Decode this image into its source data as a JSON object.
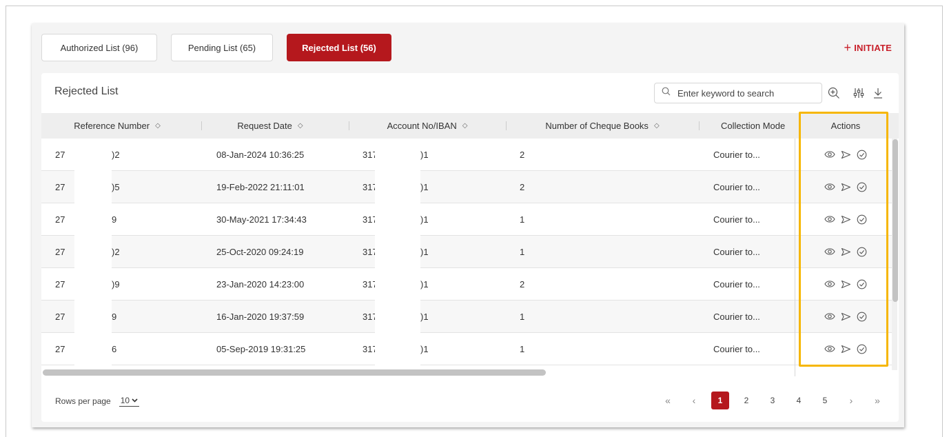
{
  "tabs": [
    {
      "label": "Authorized List (96)",
      "active": false
    },
    {
      "label": "Pending List (65)",
      "active": false
    },
    {
      "label": "Rejected List (56)",
      "active": true
    }
  ],
  "initiate_label": "INITIATE",
  "list_title": "Rejected List",
  "search": {
    "placeholder": "Enter keyword to search"
  },
  "columns": [
    "Reference Number",
    "Request Date",
    "Account No/IBAN",
    "Number of Cheque Books",
    "Collection Mode",
    "Actions"
  ],
  "rows": [
    {
      "ref_start": "27",
      "ref_end": ")2",
      "date": "08-Jan-2024 10:36:25",
      "acct_start": "317",
      "acct_end": ")1",
      "books": "2",
      "mode": "Courier to..."
    },
    {
      "ref_start": "27",
      "ref_end": ")5",
      "date": "19-Feb-2022 21:11:01",
      "acct_start": "317",
      "acct_end": ")1",
      "books": "2",
      "mode": "Courier to..."
    },
    {
      "ref_start": "27",
      "ref_end": "9",
      "date": "30-May-2021 17:34:43",
      "acct_start": "317",
      "acct_end": ")1",
      "books": "1",
      "mode": "Courier to..."
    },
    {
      "ref_start": "27",
      "ref_end": ")2",
      "date": "25-Oct-2020 09:24:19",
      "acct_start": "317",
      "acct_end": ")1",
      "books": "1",
      "mode": "Courier to..."
    },
    {
      "ref_start": "27",
      "ref_end": ")9",
      "date": "23-Jan-2020 14:23:00",
      "acct_start": "317",
      "acct_end": ")1",
      "books": "2",
      "mode": "Courier to..."
    },
    {
      "ref_start": "27",
      "ref_end": "9",
      "date": "16-Jan-2020 19:37:59",
      "acct_start": "317",
      "acct_end": ")1",
      "books": "1",
      "mode": "Courier to..."
    },
    {
      "ref_start": "27",
      "ref_end": "6",
      "date": "05-Sep-2019 19:31:25",
      "acct_start": "317",
      "acct_end": ")1",
      "books": "1",
      "mode": "Courier to..."
    }
  ],
  "footer": {
    "rows_per_page_label": "Rows per page",
    "rows_per_page_value": "10",
    "pages": [
      "1",
      "2",
      "3",
      "4",
      "5"
    ],
    "current_page": "1"
  },
  "colors": {
    "brand_red": "#b5181d",
    "highlight": "#f6b600"
  }
}
